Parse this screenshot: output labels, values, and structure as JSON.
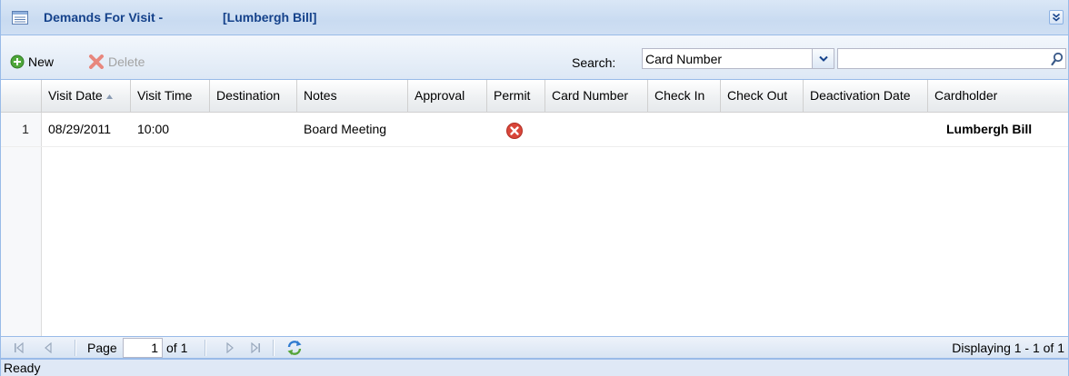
{
  "title": {
    "text": "Demands For Visit -",
    "subject": "[Lumbergh Bill]",
    "icon": "grid-list-icon",
    "collapse_icon": "double-chevron-down-icon"
  },
  "toolbar": {
    "new_label": "New",
    "delete_label": "Delete",
    "search_label": "Search:",
    "search_field_selected": "Card Number",
    "search_value": ""
  },
  "grid": {
    "columns": [
      {
        "key": "visit_date",
        "label": "Visit Date",
        "sorted": "asc"
      },
      {
        "key": "visit_time",
        "label": "Visit Time"
      },
      {
        "key": "destination",
        "label": "Destination"
      },
      {
        "key": "notes",
        "label": "Notes"
      },
      {
        "key": "approval",
        "label": "Approval"
      },
      {
        "key": "permit",
        "label": "Permit"
      },
      {
        "key": "card_number",
        "label": "Card Number"
      },
      {
        "key": "check_in",
        "label": "Check In"
      },
      {
        "key": "check_out",
        "label": "Check Out"
      },
      {
        "key": "deactivation_date",
        "label": "Deactivation Date"
      },
      {
        "key": "cardholder",
        "label": "Cardholder"
      }
    ],
    "rows": [
      {
        "row_number": "1",
        "visit_date": "08/29/2011",
        "visit_time": "10:00",
        "destination": "",
        "notes": "Board Meeting",
        "approval": "",
        "permit": "denied-x-icon",
        "card_number": "",
        "check_in": "",
        "check_out": "",
        "deactivation_date": "",
        "cardholder": "Lumbergh Bill"
      }
    ]
  },
  "paging": {
    "page_label": "Page",
    "current_page": "1",
    "of_text": "of 1",
    "display_msg": "Displaying 1 - 1 of 1"
  },
  "status": {
    "text": "Ready"
  },
  "colors": {
    "header_text": "#15428b",
    "panel_border": "#99bbe8",
    "permit_denied": "#d9463a"
  }
}
